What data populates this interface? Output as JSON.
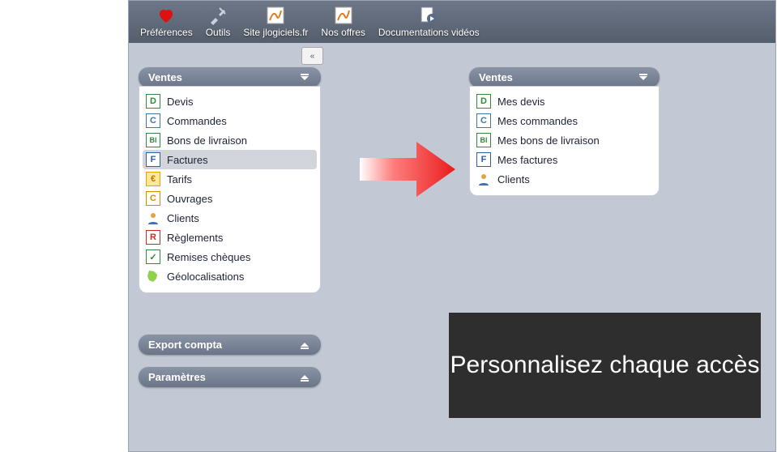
{
  "toolbar": {
    "items": [
      {
        "label": "Préférences",
        "icon": "heart"
      },
      {
        "label": "Outils",
        "icon": "tools"
      },
      {
        "label": "Site jlogiciels.fr",
        "icon": "site"
      },
      {
        "label": "Nos offres",
        "icon": "offers"
      },
      {
        "label": "Documentations vidéos",
        "icon": "video"
      }
    ]
  },
  "left_panels": {
    "ventes": {
      "title": "Ventes",
      "items": [
        {
          "label": "Devis",
          "letter": "D",
          "color": "#2e8b3d"
        },
        {
          "label": "Commandes",
          "letter": "C",
          "color": "#3a7aa8"
        },
        {
          "label": "Bons de livraison",
          "letter": "Bl",
          "color": "#2e8b3d"
        },
        {
          "label": "Factures",
          "letter": "F",
          "color": "#2b5fb0",
          "selected": true
        },
        {
          "label": "Tarifs",
          "letter": "€",
          "color": "#e4a500"
        },
        {
          "label": "Ouvrages",
          "letter": "C",
          "color": "#d98b00"
        },
        {
          "label": "Clients",
          "letter": "👤",
          "color": "#c77a1b"
        },
        {
          "label": "Règlements",
          "letter": "R",
          "color": "#c72b2b"
        },
        {
          "label": "Remises chèques",
          "letter": "✓",
          "color": "#2e8b3d"
        },
        {
          "label": "Géolocalisations",
          "letter": "⚲",
          "color": "#6fbf3f"
        }
      ]
    },
    "export": {
      "title": "Export compta"
    },
    "params": {
      "title": "Paramètres"
    }
  },
  "right_panel": {
    "title": "Ventes",
    "items": [
      {
        "label": "Mes devis",
        "letter": "D",
        "color": "#2e8b3d"
      },
      {
        "label": "Mes commandes",
        "letter": "C",
        "color": "#3a7aa8"
      },
      {
        "label": "Mes bons de livraison",
        "letter": "Bl",
        "color": "#2e8b3d"
      },
      {
        "label": "Mes factures",
        "letter": "F",
        "color": "#2b5fb0"
      },
      {
        "label": "Clients",
        "letter": "👤",
        "color": "#c77a1b"
      }
    ]
  },
  "caption": "Personnalisez chaque accès"
}
